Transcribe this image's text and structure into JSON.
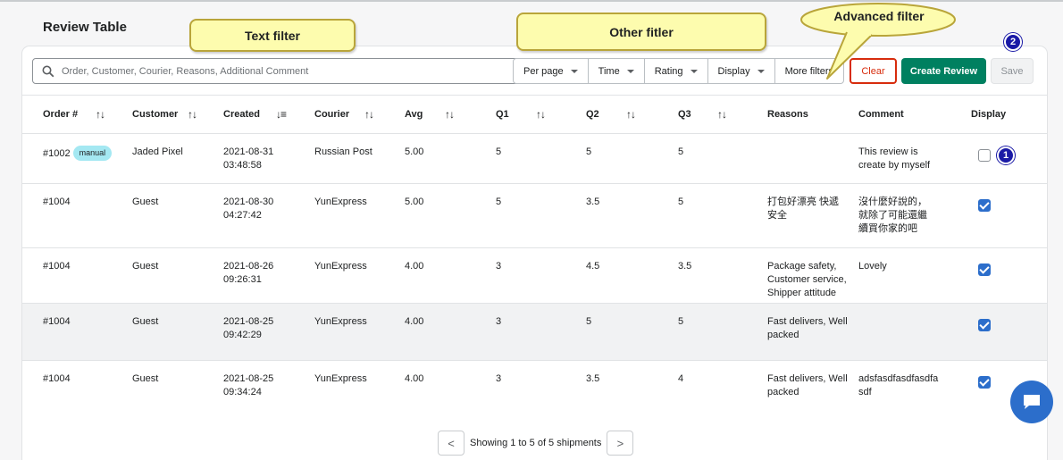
{
  "page": {
    "title": "Review Table"
  },
  "toolbar": {
    "search_placeholder": "Order, Customer, Courier, Reasons, Additional Comment",
    "filters": [
      {
        "label": "Per page",
        "dropdown": true
      },
      {
        "label": "Time",
        "dropdown": true
      },
      {
        "label": "Rating",
        "dropdown": true
      },
      {
        "label": "Display",
        "dropdown": true
      },
      {
        "label": "More filters",
        "dropdown": false
      }
    ],
    "clear_label": "Clear",
    "create_label": "Create Review",
    "save_label": "Save"
  },
  "columns": [
    {
      "label": "Order #",
      "sort_icon": "↑↓"
    },
    {
      "label": "Customer",
      "sort_icon": "↑↓"
    },
    {
      "label": "Created",
      "sort_icon": "↓≡"
    },
    {
      "label": "Courier",
      "sort_icon": "↑↓"
    },
    {
      "label": "Avg",
      "sort_icon": "↑↓"
    },
    {
      "label": "Q1",
      "sort_icon": "↑↓"
    },
    {
      "label": "Q2",
      "sort_icon": "↑↓"
    },
    {
      "label": "Q3",
      "sort_icon": "↑↓"
    },
    {
      "label": "Reasons"
    },
    {
      "label": "Comment"
    },
    {
      "label": "Display"
    }
  ],
  "rows": [
    {
      "order": "#1002",
      "badge": "manual",
      "customer": "Jaded Pixel",
      "created": "2021-08-31\n03:48:58",
      "courier": "Russian Post",
      "avg": "5.00",
      "q1": "5",
      "q2": "5",
      "q3": "5",
      "reasons": "",
      "comment": "This review is\ncreate by myself",
      "display": false
    },
    {
      "order": "#1004",
      "badge": "",
      "customer": "Guest",
      "created": "2021-08-30\n04:27:42",
      "courier": "YunExpress",
      "avg": "5.00",
      "q1": "5",
      "q2": "3.5",
      "q3": "5",
      "reasons": "打包好漂亮 快遞\n安全",
      "comment": "沒什麼好說的，\n就除了可能還繼\n續買你家的吧",
      "display": true
    },
    {
      "order": "#1004",
      "badge": "",
      "customer": "Guest",
      "created": "2021-08-26\n09:26:31",
      "courier": "YunExpress",
      "avg": "4.00",
      "q1": "3",
      "q2": "4.5",
      "q3": "3.5",
      "reasons": "Package safety,\nCustomer service,\nShipper attitude",
      "comment": "Lovely",
      "display": true
    },
    {
      "order": "#1004",
      "badge": "",
      "customer": "Guest",
      "created": "2021-08-25\n09:42:29",
      "courier": "YunExpress",
      "avg": "4.00",
      "q1": "3",
      "q2": "5",
      "q3": "5",
      "reasons": "Fast delivers, Well\npacked",
      "comment": "",
      "display": true
    },
    {
      "order": "#1004",
      "badge": "",
      "customer": "Guest",
      "created": "2021-08-25\n09:34:24",
      "courier": "YunExpress",
      "avg": "4.00",
      "q1": "3",
      "q2": "3.5",
      "q3": "4",
      "reasons": "Fast delivers, Well\npacked",
      "comment": "adsfasdfasdfasdfa\nsdf",
      "display": true
    }
  ],
  "pagination": {
    "prev": "<",
    "info": "Showing 1 to 5 of 5 shipments",
    "next": ">"
  },
  "annotations": {
    "text_filter": "Text filter",
    "other_filter": "Other fitler",
    "advanced_filter": "Advanced filter",
    "marker_1": "1",
    "marker_2": "2"
  },
  "icons": {
    "search": "search-icon",
    "chat": "chat-icon"
  },
  "colors": {
    "primary": "#008060",
    "danger": "#d72c0d",
    "checkbox": "#2c6ecb",
    "callout": "#fdfcae",
    "marker": "#1a1aa6"
  }
}
